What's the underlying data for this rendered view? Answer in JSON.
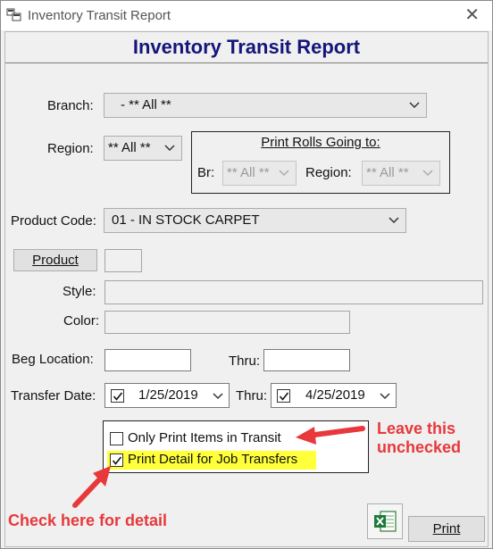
{
  "window": {
    "title": "Inventory Transit Report",
    "close_glyph": "✕"
  },
  "header": {
    "title": "Inventory Transit Report"
  },
  "branch": {
    "label": "Branch:",
    "value": "- ** All **"
  },
  "region": {
    "label": "Region:",
    "value": "** All **"
  },
  "print_rolls": {
    "title": "Print Rolls Going to:",
    "br_label": "Br:",
    "br_value": "** All **",
    "region_label": "Region:",
    "region_value": "** All **"
  },
  "product_code": {
    "label": "Product Code:",
    "value": "01 - IN STOCK CARPET"
  },
  "product": {
    "button_label": "Product",
    "value": ""
  },
  "style": {
    "label": "Style:",
    "value": ""
  },
  "color": {
    "label": "Color:",
    "value": ""
  },
  "location": {
    "beg_label": "Beg Location:",
    "beg_value": "",
    "thru_label": "Thru:",
    "thru_value": ""
  },
  "transfer_date": {
    "label": "Transfer Date:",
    "from_value": "1/25/2019",
    "from_checked": true,
    "thru_label": "Thru:",
    "thru_value": "4/25/2019",
    "thru_checked": true
  },
  "options": {
    "only_transit_label": "Only Print Items in Transit",
    "only_transit_checked": false,
    "job_transfers_label": "Print Detail for Job Transfers",
    "job_transfers_checked": true
  },
  "footer": {
    "print_label": "Print",
    "excel_icon": "excel-icon"
  },
  "annotations": {
    "leave_line1": "Leave this",
    "leave_line2": "unchecked",
    "check_here": "Check here for detail"
  },
  "colors": {
    "header": "#15157a",
    "annotation": "#e8383b",
    "highlight": "#ffff3a"
  }
}
